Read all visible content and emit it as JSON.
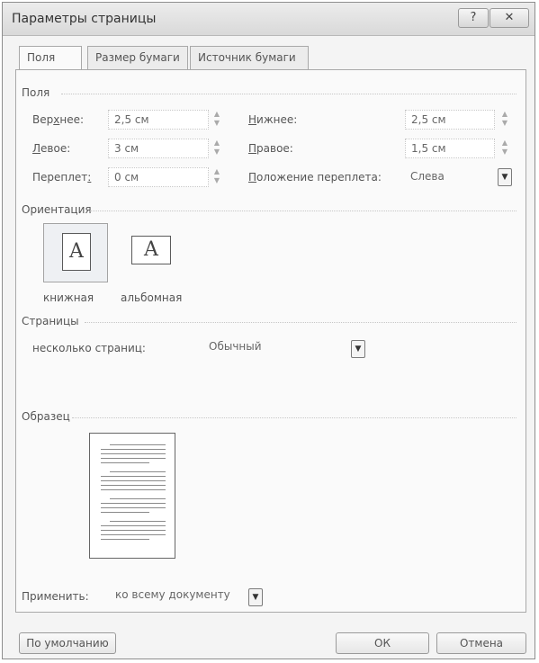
{
  "window": {
    "title": "Параметры страницы",
    "help_glyph": "?",
    "close_glyph": "✕"
  },
  "tabs": [
    {
      "label": "Поля",
      "active": true
    },
    {
      "label": "Размер бумаги",
      "active": false
    },
    {
      "label": "Источник бумаги",
      "active": false
    }
  ],
  "margins": {
    "section": "Поля",
    "top": {
      "label_pre": "Вер",
      "label_u": "х",
      "label_post": "нее:",
      "value": "2,5 см"
    },
    "bottom": {
      "label_pre": "",
      "label_u": "Н",
      "label_post": "ижнее:",
      "value": "2,5 см"
    },
    "left": {
      "label_pre": "",
      "label_u": "Л",
      "label_post": "евое:",
      "value": "3 см"
    },
    "right": {
      "label_pre": "",
      "label_u": "П",
      "label_post": "равое:",
      "value": "1,5 см"
    },
    "gutter": {
      "label_pre": "Переплет",
      "label_u": ":",
      "label_post": "",
      "value": "0 см"
    },
    "gutter_position": {
      "label_pre": "",
      "label_u": "П",
      "label_post": "оложение переплета:",
      "value": "Слева"
    }
  },
  "orientation": {
    "section": "Ориентация",
    "portrait": "книжная",
    "landscape": "альбомная",
    "icon_letter": "A",
    "selected": "portrait"
  },
  "pages": {
    "section": "Страницы",
    "multiple_label": "несколько страниц:",
    "multiple_value": "Обычный"
  },
  "preview": {
    "section": "Образец"
  },
  "apply": {
    "label": "Применить:",
    "value": "ко всему документу"
  },
  "buttons": {
    "default": "По умолчанию",
    "ok": "ОК",
    "cancel": "Отмена"
  },
  "icons": {
    "dropdown": "▼",
    "spin_up": "▲",
    "spin_down": "▼"
  }
}
